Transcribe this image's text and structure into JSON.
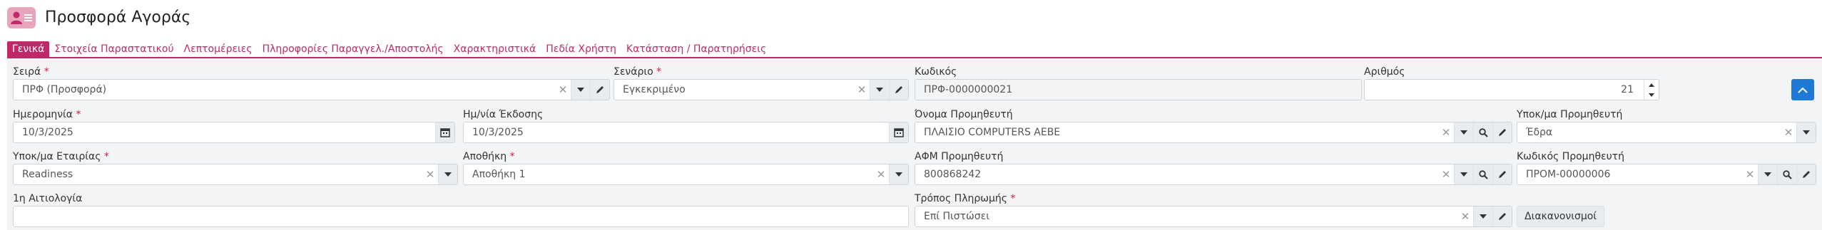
{
  "header": {
    "title": "Προσφορά Αγοράς",
    "icon": "user-list-icon"
  },
  "tabs": [
    {
      "label": "Γενικά"
    },
    {
      "label": "Στοιχεία Παραστατικού"
    },
    {
      "label": "Λεπτομέρειες"
    },
    {
      "label": "Πληροφορίες Παραγγελ./Αποστολής"
    },
    {
      "label": "Χαρακτηριστικά"
    },
    {
      "label": "Πεδία Χρήστη"
    },
    {
      "label": "Κατάσταση / Παρατηρήσεις"
    }
  ],
  "form": {
    "seira": {
      "label": "Σειρά",
      "value": "ΠΡΦ (Προσφορά)"
    },
    "senario": {
      "label": "Σενάριο",
      "value": "Εγκεκριμένο"
    },
    "kodikos": {
      "label": "Κωδικός",
      "value": "ΠΡΦ-0000000021"
    },
    "arithmos": {
      "label": "Αριθμός",
      "value": "21"
    },
    "hmerominia": {
      "label": "Ημερομηνία",
      "value": "10/3/2025"
    },
    "hmnia_ekdosis": {
      "label": "Ημ/νία Έκδοσης",
      "value": "10/3/2025"
    },
    "onoma_promitheuti": {
      "label": "Όνομα Προμηθευτή",
      "value": "ΠΛΑΙΣΙΟ COMPUTERS ΑΕΒΕ"
    },
    "ypokma_promitheuti": {
      "label": "Υποκ/μα Προμηθευτή",
      "value": "Έδρα"
    },
    "ypokma_etairias": {
      "label": "Υποκ/μα Εταιρίας",
      "value": "Readiness"
    },
    "apothiki": {
      "label": "Αποθήκη",
      "value": "Αποθήκη 1"
    },
    "afm_promitheuti": {
      "label": "ΑΦΜ Προμηθευτή",
      "value": "800868242"
    },
    "kodikos_promitheuti": {
      "label": "Κωδικός Προμηθευτή",
      "value": "ΠΡΟΜ-00000006"
    },
    "aitiologia": {
      "label": "1η Αιτιολογία",
      "value": ""
    },
    "tropos_pliromis": {
      "label": "Τρόπος Πληρωμής",
      "value": "Επί Πιστώσει"
    },
    "diakanonismoi": {
      "label": "Διακανονισμοί"
    },
    "required_mark": "*"
  },
  "colors": {
    "accent": "#c0286a",
    "primary_button": "#1e7ad6",
    "panel_bg": "#f3f4f6"
  }
}
